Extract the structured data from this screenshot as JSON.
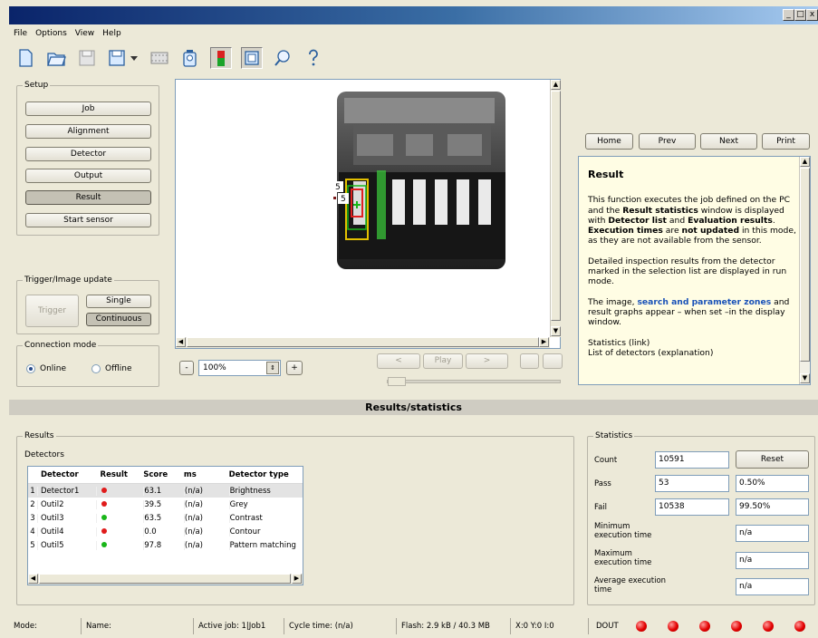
{
  "window": {
    "min": "_",
    "max": "□",
    "close": "x"
  },
  "menu": [
    "File",
    "Options",
    "View",
    "Help"
  ],
  "toolbar": {
    "icons": [
      "new-icon",
      "open-icon",
      "save-icon",
      "save-as-icon",
      "dropdown-arrow-icon",
      "film-icon",
      "camera-icon",
      "sensor-icon",
      "image-window-icon",
      "zoom-icon",
      "help-icon"
    ]
  },
  "setup": {
    "legend": "Setup",
    "buttons": [
      "Job",
      "Alignment",
      "Detector",
      "Output",
      "Result",
      "Start sensor"
    ]
  },
  "trigger": {
    "legend": "Trigger/Image update",
    "trigger": "Trigger",
    "single": "Single",
    "continuous": "Continuous"
  },
  "connection": {
    "legend": "Connection mode",
    "online": "Online",
    "offline": "Offline"
  },
  "image": {
    "marker_a": "5",
    "marker_b": "5"
  },
  "zoom": {
    "minus": "-",
    "value": "100%",
    "plus": "+"
  },
  "playback": {
    "prev": "<",
    "play": "Play",
    "next": ">"
  },
  "nav": {
    "home": "Home",
    "prev": "Prev",
    "next": "Next",
    "print": "Print"
  },
  "help": {
    "title": "Result",
    "p1_a": "This function executes the job defined on the PC and the ",
    "p1_b": "Result statistics",
    "p1_c": " window is displayed with ",
    "p1_d": "Detector list",
    "p1_e": " and ",
    "p1_f": "Evaluation results",
    "p1_g": ". ",
    "p1_h": "Execution times",
    "p1_i": " are ",
    "p1_j": "not updated",
    "p1_k": " in this mode, as they are not available from the sensor.",
    "p2": "Detailed inspection results from the detector marked in the selection list are displayed in run mode.",
    "p3_a": "The image, ",
    "p3_b": "search and parameter zones",
    "p3_c": " and result graphs appear – when set –in the display window.",
    "p4": "Statistics (link)",
    "p5": "List of detectors (explanation)"
  },
  "results_header": "Results/statistics",
  "results": {
    "legend": "Results",
    "detectors_label": "Detectors",
    "columns": [
      "Detector",
      "Result",
      "Score",
      "ms",
      "Detector type"
    ],
    "rows": [
      {
        "n": "1",
        "name": "Detector1",
        "result": "red",
        "score": "63.1",
        "ms": "(n/a)",
        "type": "Brightness"
      },
      {
        "n": "2",
        "name": "Outil2",
        "result": "red",
        "score": "39.5",
        "ms": "(n/a)",
        "type": "Grey"
      },
      {
        "n": "3",
        "name": "Outil3",
        "result": "green",
        "score": "63.5",
        "ms": "(n/a)",
        "type": "Contrast"
      },
      {
        "n": "4",
        "name": "Outil4",
        "result": "red",
        "score": "0.0",
        "ms": "(n/a)",
        "type": "Contour"
      },
      {
        "n": "5",
        "name": "Outil5",
        "result": "green",
        "score": "97.8",
        "ms": "(n/a)",
        "type": "Pattern matching"
      }
    ]
  },
  "statistics": {
    "legend": "Statistics",
    "count_label": "Count",
    "count": "10591",
    "reset": "Reset",
    "pass_label": "Pass",
    "pass": "53",
    "pass_pct": "0.50%",
    "fail_label": "Fail",
    "fail": "10538",
    "fail_pct": "99.50%",
    "min_label": "Minimum execution time",
    "min": "n/a",
    "max_label": "Maximum execution time",
    "max": "n/a",
    "avg_label": "Average execution time",
    "avg": "n/a"
  },
  "status": {
    "mode": "Mode:",
    "name": "Name:",
    "active_job": "Active job:  1|Job1",
    "cycle": "Cycle time:  (n/a)",
    "flash": "Flash:  2.9 kB / 40.3 MB",
    "coords": "X:0 Y:0 I:0",
    "dout": "DOUT"
  },
  "colors": {
    "led_red": "#e30000",
    "ok_green": "#19b619",
    "fail_red": "#e01b1b",
    "help_bg": "#fffde4",
    "link": "#1a52b8"
  }
}
